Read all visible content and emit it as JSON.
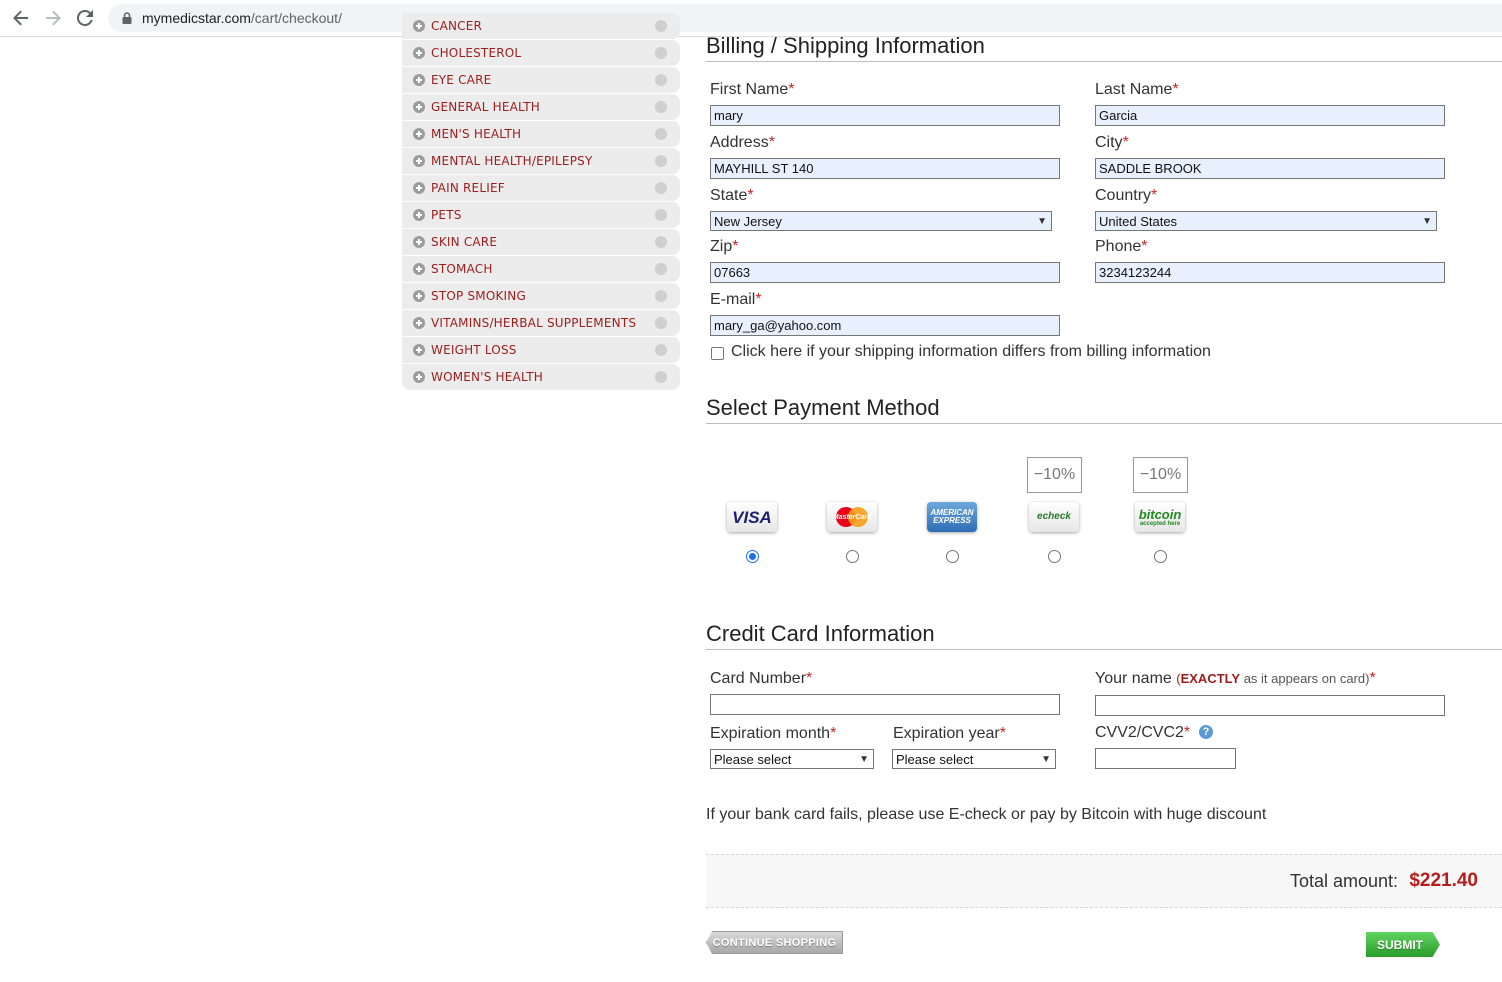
{
  "browser": {
    "url_host": "mymedicstar.com",
    "url_path": "/cart/checkout/"
  },
  "sidebar": {
    "items": [
      {
        "label": "CANCER",
        "icon": "ribbon-icon"
      },
      {
        "label": "CHOLESTEROL",
        "icon": "cell-icon"
      },
      {
        "label": "EYE CARE",
        "icon": "eye-icon"
      },
      {
        "label": "GENERAL HEALTH",
        "icon": "medkit-icon"
      },
      {
        "label": "MEN'S HEALTH",
        "icon": "man-head-icon"
      },
      {
        "label": "MENTAL HEALTH/EPILEPSY",
        "icon": "brain-icon"
      },
      {
        "label": "PAIN RELIEF",
        "icon": "person-icon"
      },
      {
        "label": "PETS",
        "icon": "cat-icon"
      },
      {
        "label": "SKIN CARE",
        "icon": "tube-icon"
      },
      {
        "label": "STOMACH",
        "icon": "stomach-icon"
      },
      {
        "label": "STOP SMOKING",
        "icon": "no-smoking-icon"
      },
      {
        "label": "VITAMINS/HERBAL SUPPLEMENTS",
        "icon": "bottle-icon"
      },
      {
        "label": "WEIGHT LOSS",
        "icon": "scale-icon"
      },
      {
        "label": "WOMEN'S HEALTH",
        "icon": "woman-head-icon"
      }
    ]
  },
  "billing": {
    "title": "Billing / Shipping Information",
    "first_name_label": "First Name",
    "first_name": "mary",
    "last_name_label": "Last Name",
    "last_name": "Garcia",
    "address_label": "Address",
    "address": "MAYHILL ST 140",
    "city_label": "City",
    "city": "SADDLE BROOK",
    "state_label": "State",
    "state": "New Jersey",
    "country_label": "Country",
    "country": "United States",
    "zip_label": "Zip",
    "zip": "07663",
    "phone_label": "Phone",
    "phone": "3234123244",
    "email_label": "E-mail",
    "email": "mary_ga@yahoo.com",
    "shipping_differs_label": "Click here if your shipping information differs from billing information",
    "required_mark": "*"
  },
  "payment": {
    "title": "Select Payment Method",
    "methods": [
      {
        "name": "VISA",
        "discount": "",
        "selected": true
      },
      {
        "name": "MasterCard",
        "discount": "",
        "selected": false
      },
      {
        "name": "AMERICAN EXPRESS",
        "discount": "",
        "selected": false
      },
      {
        "name": "echeck",
        "discount": "−10%",
        "selected": false
      },
      {
        "name": "bitcoin",
        "discount": "−10%",
        "selected": false
      }
    ],
    "bitcoin_sub": "accepted here"
  },
  "credit_card": {
    "title": "Credit Card Information",
    "card_number_label": "Card Number",
    "your_name_label": "Your name",
    "your_name_note_strong": "EXACTLY",
    "your_name_note": "as it appears on card)",
    "your_name_note_open": "(",
    "exp_month_label": "Expiration month",
    "exp_month_value": "Please select",
    "exp_year_label": "Expiration year",
    "exp_year_value": "Please select",
    "cvv_label": "CVV2/CVC2",
    "cvv_help": "?"
  },
  "notice": "If your bank card fails, please use E-check or pay by Bitcoin with huge discount",
  "total": {
    "label": "Total amount:",
    "value": "$221.40"
  },
  "buttons": {
    "continue": "CONTINUE SHOPPING",
    "submit": "SUBMIT"
  }
}
